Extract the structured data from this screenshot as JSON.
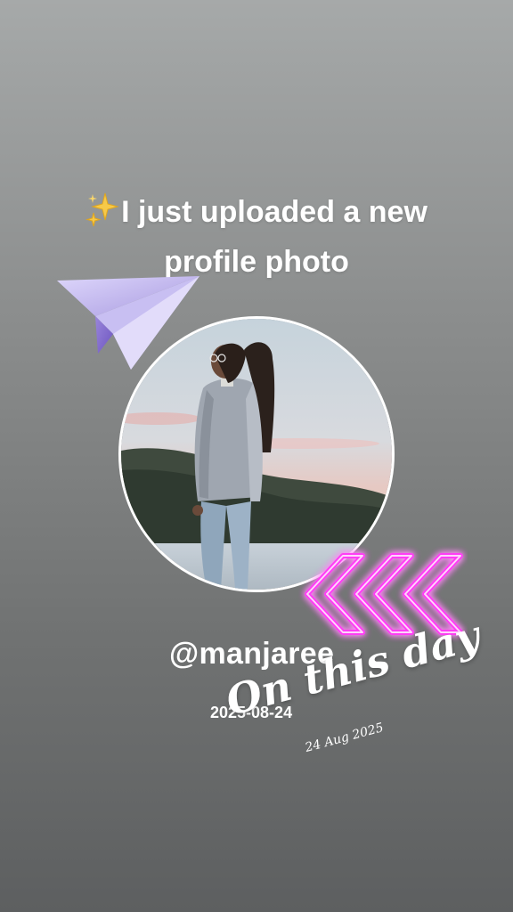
{
  "post": {
    "headline_line1": "I just uploaded a new",
    "headline_line2": "profile photo",
    "username": "@manjaree",
    "date": "2025-08-24"
  },
  "sticker": {
    "title": "On this day",
    "date": "24 Aug 2025"
  },
  "icons": {
    "sparkle": "sparkles-icon",
    "plane": "paper-plane-icon",
    "chevrons": "neon-chevrons-icon"
  },
  "colors": {
    "background_top": "#a6a9a9",
    "background_bottom": "#5d5f60",
    "text": "#ffffff",
    "plane": "#b3a3e8",
    "neon": "#ff3df5"
  }
}
